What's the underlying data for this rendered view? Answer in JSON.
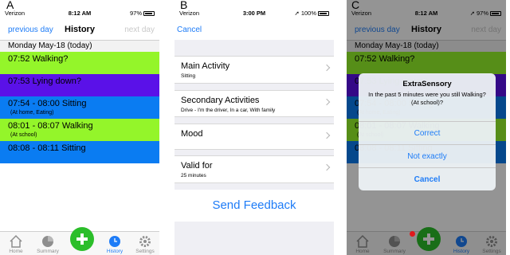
{
  "panel_letters": [
    "A",
    "B",
    "C"
  ],
  "status": {
    "a": {
      "carrier": "Verizon",
      "time": "8:12 AM",
      "battery": "97%"
    },
    "b": {
      "carrier": "Verizon",
      "time": "3:00 PM",
      "battery": "100%"
    },
    "c": {
      "carrier": "Verizon",
      "time": "8:12 AM",
      "battery": "97%"
    }
  },
  "history_nav": {
    "previous": "previous day",
    "title": "History",
    "next": "next day"
  },
  "day_header": "Monday May-18 (today)",
  "events": [
    {
      "main": "07:52   Walking?",
      "sub": "",
      "color": "#94f52a"
    },
    {
      "main": "07:53   Lying down?",
      "sub": "",
      "color": "#5a11e8"
    },
    {
      "main": "07:54 - 08:00   Sitting",
      "sub": "(At home, Eating)",
      "color": "#0a7cf2"
    },
    {
      "main": "08:01 - 08:07   Walking",
      "sub": "(At school)",
      "color": "#94f52a"
    },
    {
      "main": "08:08 - 08:11   Sitting",
      "sub": "",
      "color": "#0a7cf2"
    }
  ],
  "tabs": [
    {
      "label": "Home",
      "icon": "home-icon"
    },
    {
      "label": "Summary",
      "icon": "pie-chart-icon"
    },
    {
      "label": "",
      "icon": "plus-icon"
    },
    {
      "label": "History",
      "icon": "clock-icon"
    },
    {
      "label": "Settings",
      "icon": "gear-icon"
    }
  ],
  "feedback": {
    "cancel": "Cancel",
    "cells": [
      {
        "title": "Main Activity",
        "sub": "Sitting"
      },
      {
        "title": "Secondary Activities",
        "sub": "Drive - I'm the driver, In a car, With family"
      },
      {
        "title": "Mood",
        "sub": ""
      },
      {
        "title": "Valid for",
        "sub": "25 minutes"
      }
    ],
    "send": "Send Feedback"
  },
  "alert": {
    "title": "ExtraSensory",
    "message": "In the past 5 minutes were you still Walking? (At school)?",
    "buttons": [
      "Correct",
      "Not exactly",
      "Cancel"
    ]
  },
  "colors": {
    "accent": "#1e7cf7",
    "walking": "#94f52a",
    "lying": "#5a11e8",
    "sitting": "#0a7cf2",
    "add": "#2bbe2a"
  }
}
